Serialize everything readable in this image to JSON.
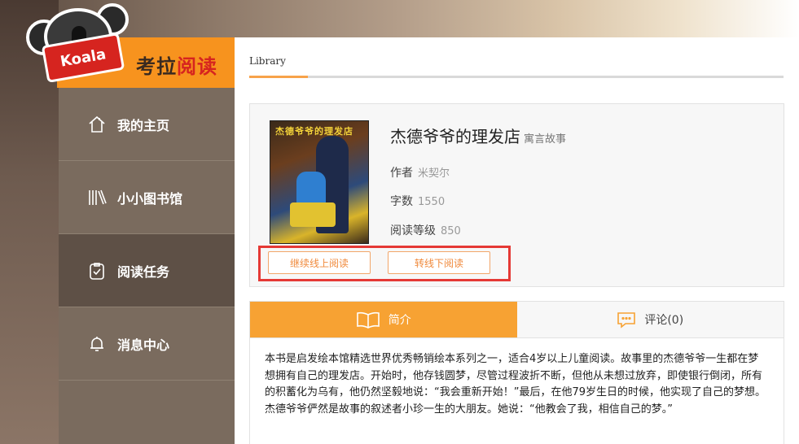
{
  "logo": {
    "badge_text": "Koala",
    "title_part1": "考拉",
    "title_part2": "阅读"
  },
  "sidebar": {
    "items": [
      {
        "label": "我的主页",
        "icon": "home-icon"
      },
      {
        "label": "小小图书馆",
        "icon": "library-icon"
      },
      {
        "label": "阅读任务",
        "icon": "clipboard-check-icon",
        "active": true
      },
      {
        "label": "消息中心",
        "icon": "bell-icon"
      }
    ]
  },
  "breadcrumb": {
    "label": "Library"
  },
  "book": {
    "cover_title": "杰德爷爷的理发店",
    "title": "杰德爷爷的理发店",
    "genre": "寓言故事",
    "author_label": "作者",
    "author": "米契尔",
    "words_label": "字数",
    "words": "1550",
    "level_label": "阅读等级",
    "level": "850",
    "btn_online": "继续线上阅读",
    "btn_offline": "转线下阅读"
  },
  "tabs": {
    "intro": "简介",
    "comments": "评论(0)"
  },
  "summary": {
    "text": "本书是启发绘本馆精选世界优秀畅销绘本系列之一，适合4岁以上儿童阅读。故事里的杰德爷爷一生都在梦想拥有自己的理发店。开始时，他存钱圆梦，尽管过程波折不断，但他从未想过放弃，即使银行倒闭，所有的积蓄化为乌有，他仍然坚毅地说：“我会重新开始！”最后，在他79岁生日的时候，他实现了自己的梦想。杰德爷爷俨然是故事的叙述者小珍一生的大朋友。她说：“他教会了我，相信自己的梦。”"
  },
  "colors": {
    "accent": "#f7a233",
    "logo_band": "#f7931e",
    "highlight": "#e53935",
    "sidebar": "#7a6b5e",
    "sidebar_active": "#5e5046"
  }
}
